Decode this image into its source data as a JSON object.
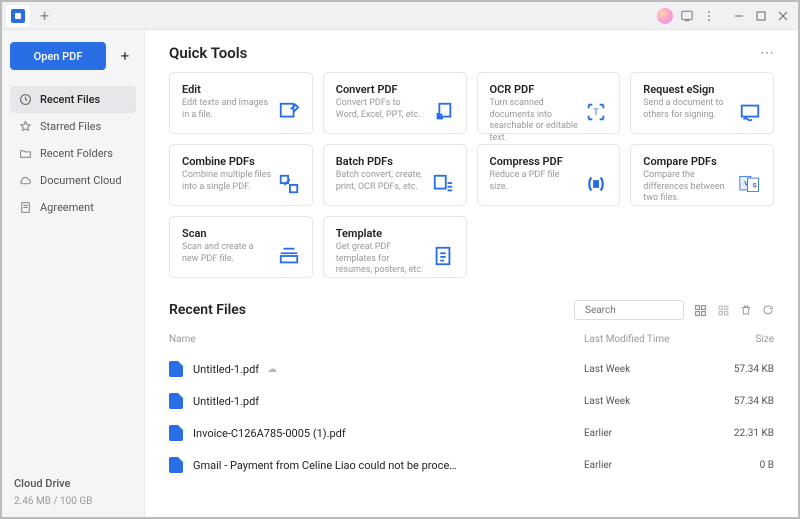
{
  "titlebar": {
    "new_tab": "+"
  },
  "sidebar": {
    "open_label": "Open PDF",
    "items": [
      {
        "label": "Recent Files",
        "icon": "recent"
      },
      {
        "label": "Starred Files",
        "icon": "star"
      },
      {
        "label": "Recent Folders",
        "icon": "folder"
      },
      {
        "label": "Document Cloud",
        "icon": "cloud"
      },
      {
        "label": "Agreement",
        "icon": "agreement"
      }
    ],
    "active_index": 0,
    "cloud_drive_label": "Cloud Drive",
    "storage_text": "2.46 MB / 100 GB"
  },
  "quick_tools": {
    "title": "Quick Tools",
    "tools": [
      {
        "title": "Edit",
        "desc": "Edit texts and images in a file."
      },
      {
        "title": "Convert PDF",
        "desc": "Convert PDFs to Word, Excel, PPT, etc."
      },
      {
        "title": "OCR PDF",
        "desc": "Turn scanned documents into searchable or editable text."
      },
      {
        "title": "Request eSign",
        "desc": "Send a document to others for signing."
      },
      {
        "title": "Combine PDFs",
        "desc": "Combine multiple files into a single PDF."
      },
      {
        "title": "Batch PDFs",
        "desc": "Batch convert, create, print, OCR PDFs, etc."
      },
      {
        "title": "Compress PDF",
        "desc": "Reduce a PDF file size."
      },
      {
        "title": "Compare PDFs",
        "desc": "Compare the differences between two files."
      },
      {
        "title": "Scan",
        "desc": "Scan and create a new PDF file."
      },
      {
        "title": "Template",
        "desc": "Get great PDF templates for resumes, posters, etc."
      }
    ]
  },
  "recent_files": {
    "title": "Recent Files",
    "search_placeholder": "Search",
    "columns": {
      "name": "Name",
      "time": "Last Modified Time",
      "size": "Size"
    },
    "rows": [
      {
        "name": "Untitled-1.pdf",
        "has_cloud": true,
        "time": "Last Week",
        "size": "57.34 KB"
      },
      {
        "name": "Untitled-1.pdf",
        "has_cloud": false,
        "time": "Last Week",
        "size": "57.34 KB"
      },
      {
        "name": "Invoice-C126A785-0005 (1).pdf",
        "has_cloud": false,
        "time": "Earlier",
        "size": "22.31 KB"
      },
      {
        "name": "Gmail - Payment from Celine Liao could not be proce…",
        "has_cloud": false,
        "time": "Earlier",
        "size": "0 B"
      }
    ]
  }
}
